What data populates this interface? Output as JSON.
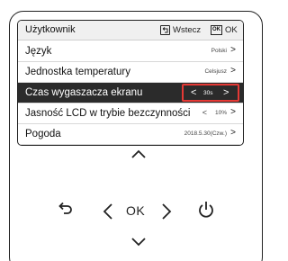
{
  "header": {
    "title": "Użytkownik",
    "back_label": "Wstecz",
    "ok_icon_text": "OK",
    "ok_label": "OK"
  },
  "menu": {
    "items": [
      {
        "label": "Język",
        "value": "Polski"
      },
      {
        "label": "Jednostka temperatury",
        "value": "Celsjusz"
      },
      {
        "label": "Czas wygaszacza ekranu",
        "value": "30s"
      },
      {
        "label": "Jasność LCD w trybie bezczynności",
        "value": "10%"
      },
      {
        "label": "Pogoda",
        "value": "2018.5.30(Czw.)"
      }
    ],
    "selected_index": 2
  },
  "keypad": {
    "ok_label": "OK"
  },
  "colors": {
    "selected_row_bg": "#2b2b2b",
    "highlight_border": "#e53935"
  }
}
